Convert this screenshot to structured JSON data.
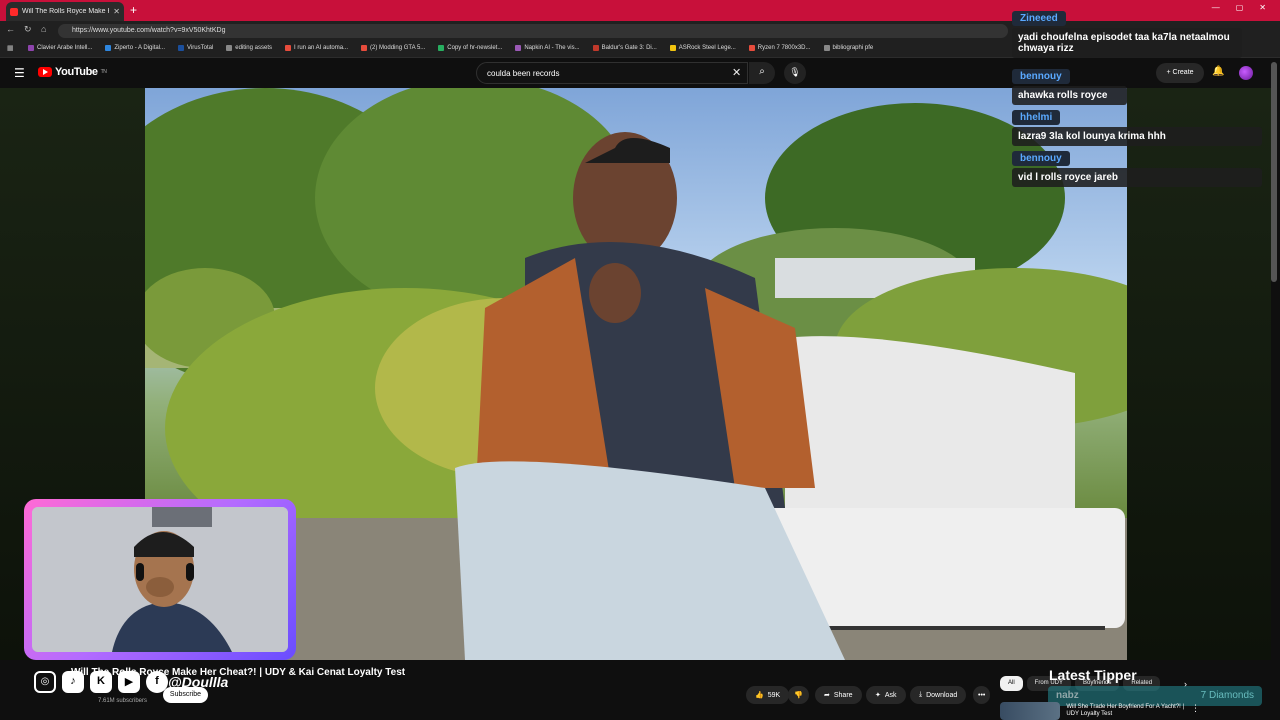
{
  "browser": {
    "tab_title": "Will The Rolls Royce Make Her",
    "url": "https://www.youtube.com/watch?v=9xV50KhtKDg",
    "bookmarks": [
      {
        "label": "Clavier Arabe Intell...",
        "color": "#8e44ad"
      },
      {
        "label": "Ziperto - A Digital...",
        "color": "#2e86de"
      },
      {
        "label": "VirusTotal",
        "color": "#1b4f9c"
      },
      {
        "label": "editing assets",
        "color": "#888888"
      },
      {
        "label": "I run an AI automa...",
        "color": "#e74c3c"
      },
      {
        "label": "(2) Modding GTA 5...",
        "color": "#e74c3c"
      },
      {
        "label": "Copy of hr-newslet...",
        "color": "#27ae60"
      },
      {
        "label": "Napkin AI - The vis...",
        "color": "#9b59b6"
      },
      {
        "label": "Baldur's Gate 3: Di...",
        "color": "#c0392b"
      },
      {
        "label": "ASRock Steel Lege...",
        "color": "#f1c40f"
      },
      {
        "label": "Ryzen 7 7800x3D...",
        "color": "#e74c3c"
      },
      {
        "label": "bibliographi pfe",
        "color": "#888888"
      }
    ]
  },
  "youtube": {
    "logo_text": "YouTube",
    "logo_sup": "TN",
    "search_value": "coulda been records",
    "create_label": "Create",
    "video_title": "Will The Rolls Royce Make Her Cheat?! | UDY & Kai Cenat Loyalty Test",
    "subscribers": "7.61M subscribers",
    "subscribe_label": "Subscribe",
    "actions": {
      "likes": "59K",
      "share": "Share",
      "ask": "Ask",
      "download": "Download"
    },
    "chips": [
      "All",
      "From UDY",
      "Boyfriends",
      "Related"
    ],
    "rec_title": "Will She Trade Her Boyfriend For A Yacht?! | UDY Loyalty Test"
  },
  "chat": [
    {
      "name": "Zineeed",
      "msg": "yadi choufelna episodet taa ka7la netaalmou chwaya rizz"
    },
    {
      "name": "bennouy",
      "msg": "ahawka rolls royce"
    },
    {
      "name": "hhelmi",
      "msg": "lazra9 3la kol lounya krima hhh"
    },
    {
      "name": "bennouy",
      "msg": "vid l rolls royce jareb"
    }
  ],
  "overlay": {
    "handle": "@Doullla",
    "latest_tipper_label": "Latest Tipper",
    "tipper_name": "nabz",
    "tipper_amount": "7 Diamonds"
  },
  "colors": {
    "tabbar": "#c8103a",
    "yt_red": "#ff0000",
    "chat_name": "#5aa9ff",
    "cam_border": "#b36bff"
  }
}
